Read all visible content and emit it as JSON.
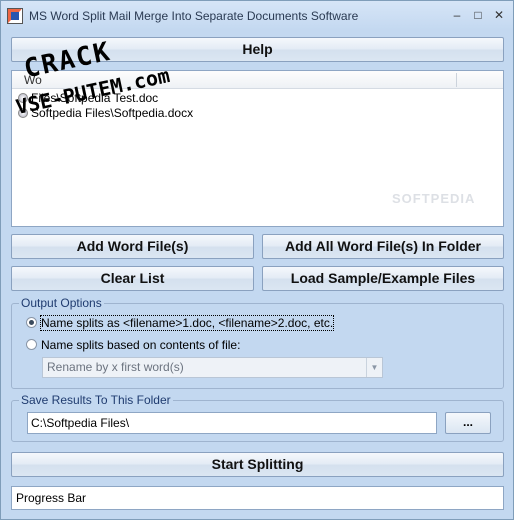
{
  "window": {
    "title": "MS Word Split Mail Merge Into Separate Documents Software",
    "minimize_glyph": "–",
    "maximize_glyph": "□",
    "close_glyph": "✕"
  },
  "watermark": {
    "line1": "CRACK",
    "line2": "VSE-PUTEM.com"
  },
  "bg_watermark": "SOFTPEDIA",
  "help_label": "Help",
  "file_list": {
    "column_header": "Wo",
    "rows": [
      {
        "text": "Files\\Softpedia Test.doc"
      },
      {
        "text": "Softpedia Files\\Softpedia.docx"
      }
    ]
  },
  "buttons": {
    "add_files": "Add Word File(s)",
    "add_all": "Add All Word File(s) In Folder",
    "clear_list": "Clear List",
    "load_sample": "Load Sample/Example Files",
    "browse": "...",
    "start": "Start Splitting"
  },
  "output_options": {
    "label": "Output Options",
    "option1": "Name splits as <filename>1.doc, <filename>2.doc, etc.",
    "option2": "Name splits based on contents of file:",
    "option1_selected": true,
    "rename_select_value": "Rename by x first word(s)"
  },
  "save_folder": {
    "label": "Save Results To This Folder",
    "path": "C:\\Softpedia Files\\"
  },
  "progress_text": "Progress Bar"
}
